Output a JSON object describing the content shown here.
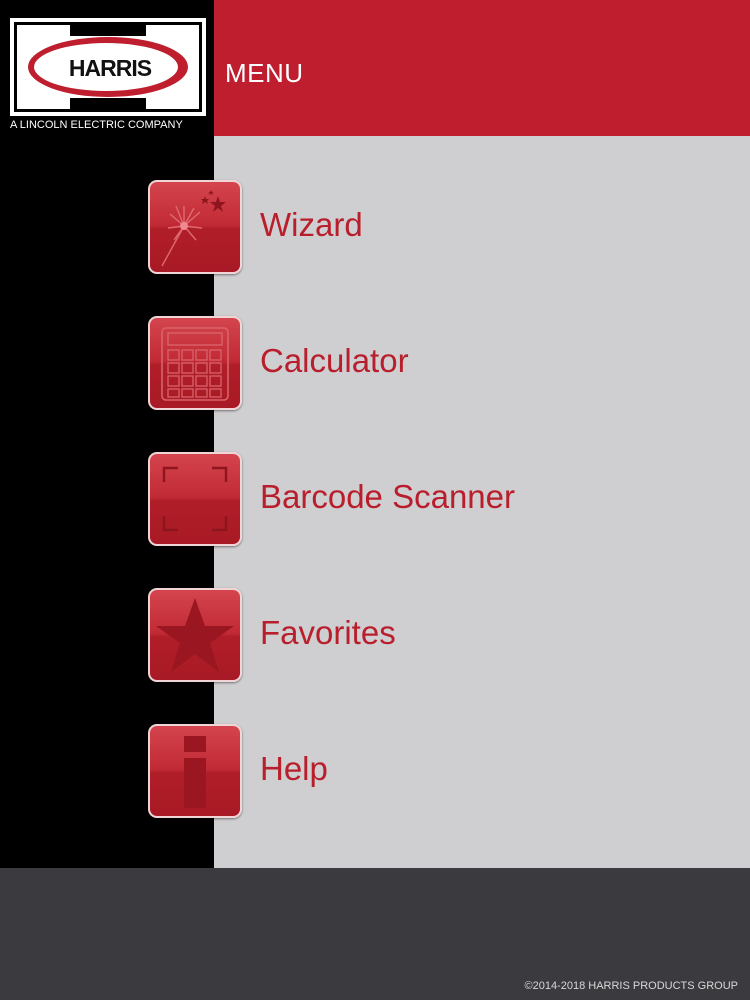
{
  "brand": {
    "logo_text": "HARRIS",
    "tagline": "A LINCOLN ELECTRIC COMPANY"
  },
  "header": {
    "title": "MENU"
  },
  "menu": {
    "items": [
      {
        "label": "Wizard",
        "icon": "wand-sparkle-icon"
      },
      {
        "label": "Calculator",
        "icon": "calculator-icon"
      },
      {
        "label": "Barcode Scanner",
        "icon": "barcode-scan-frame-icon"
      },
      {
        "label": "Favorites",
        "icon": "star-icon"
      },
      {
        "label": "Help",
        "icon": "info-icon"
      }
    ]
  },
  "footer": {
    "copyright": "©2014-2018 HARRIS PRODUCTS GROUP"
  },
  "colors": {
    "brand_red": "#be1e2d",
    "label_red": "#b91e2c",
    "sidebar": "#000000",
    "content_bg": "#cfcfd1",
    "footer_bg": "#3b3a3e"
  }
}
